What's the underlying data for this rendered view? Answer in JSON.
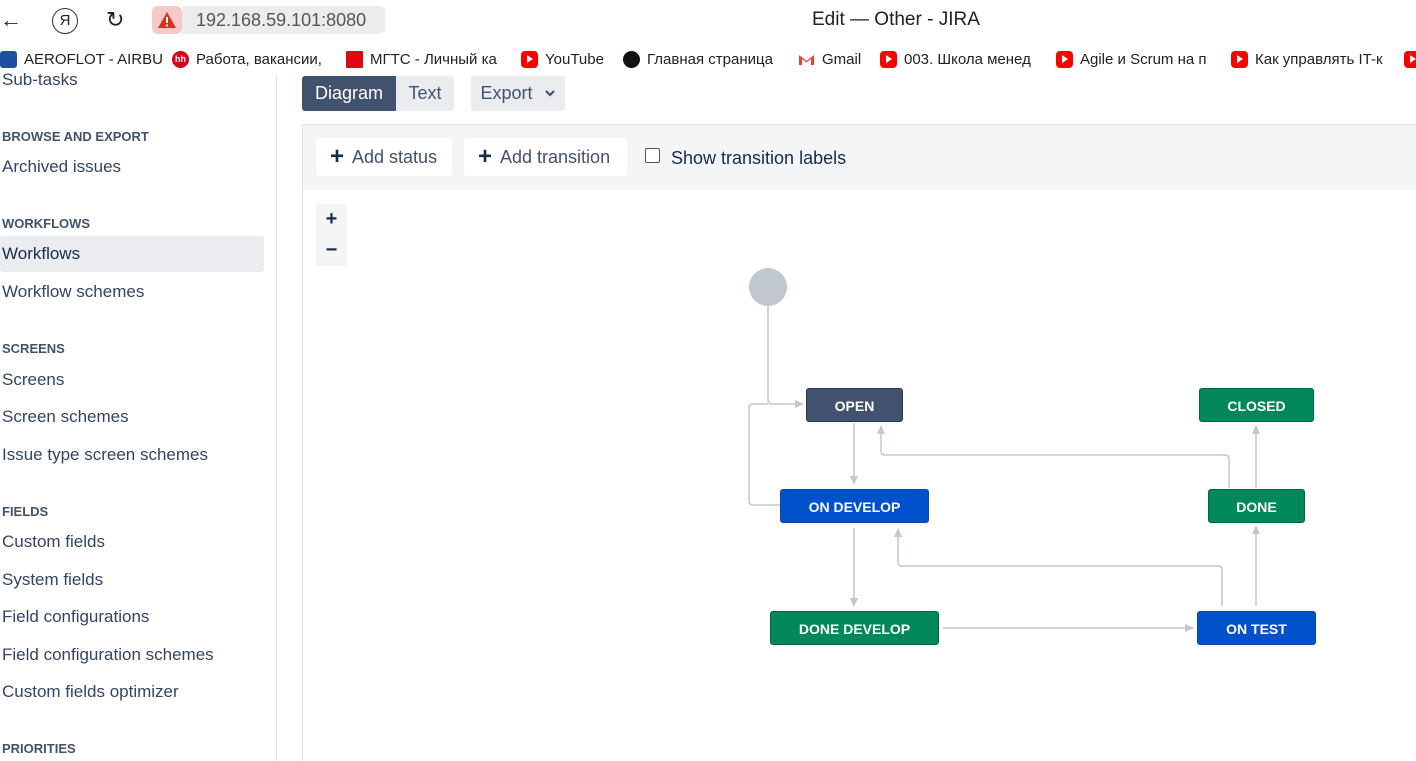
{
  "browser": {
    "address": "192.168.59.101:8080",
    "window_title": "Edit — Other - JIRA",
    "nav_icons": [
      "back-arrow-icon",
      "yandex-icon",
      "reload-icon",
      "warning-icon"
    ],
    "yandex_glyph": "Я",
    "bookmarks": [
      {
        "label": "AEROFLOT - AIRBU",
        "icon": "aeroflot-icon"
      },
      {
        "label": "Работа, вакансии,",
        "icon": "hh-icon",
        "glyph": "hh"
      },
      {
        "label": "МГТС - Личный ка",
        "icon": "mgts-icon"
      },
      {
        "label": "YouTube",
        "icon": "youtube-icon"
      },
      {
        "label": "Главная страница",
        "icon": "compass-icon"
      },
      {
        "label": "Gmail",
        "icon": "gmail-icon"
      },
      {
        "label": "003. Школа менед",
        "icon": "youtube-icon"
      },
      {
        "label": "Agile и Scrum на п",
        "icon": "youtube-icon"
      },
      {
        "label": "Как управлять IT-к",
        "icon": "youtube-icon"
      }
    ]
  },
  "sidebar": {
    "subtasks": "Sub-tasks",
    "sections": {
      "browse": {
        "heading": "BROWSE AND EXPORT",
        "items": [
          "Archived issues"
        ]
      },
      "workflows": {
        "heading": "WORKFLOWS",
        "items": [
          "Workflows",
          "Workflow schemes"
        ]
      },
      "screens": {
        "heading": "SCREENS",
        "items": [
          "Screens",
          "Screen schemes",
          "Issue type screen schemes"
        ]
      },
      "fields": {
        "heading": "FIELDS",
        "items": [
          "Custom fields",
          "System fields",
          "Field configurations",
          "Field configuration schemes",
          "Custom fields optimizer"
        ]
      },
      "priorities": {
        "heading": "PRIORITIES"
      }
    },
    "active_item": "Workflows"
  },
  "main": {
    "tabs": {
      "diagram": "Diagram",
      "text": "Text",
      "export": "Export"
    },
    "active_tab": "Diagram",
    "toolbar": {
      "add_status": "Add status",
      "add_transition": "Add transition",
      "show_labels": "Show transition labels",
      "show_labels_checked": false
    },
    "zoom": {
      "in": "+",
      "out": "−"
    }
  },
  "workflow": {
    "statuses": {
      "open": "OPEN",
      "closed": "CLOSED",
      "on_develop": "ON DEVELOP",
      "done": "DONE",
      "done_develop": "DONE DEVELOP",
      "on_test": "ON TEST"
    },
    "colors": {
      "todo": "#42526e",
      "done": "#00875a",
      "in_progress": "#0052cc"
    }
  }
}
